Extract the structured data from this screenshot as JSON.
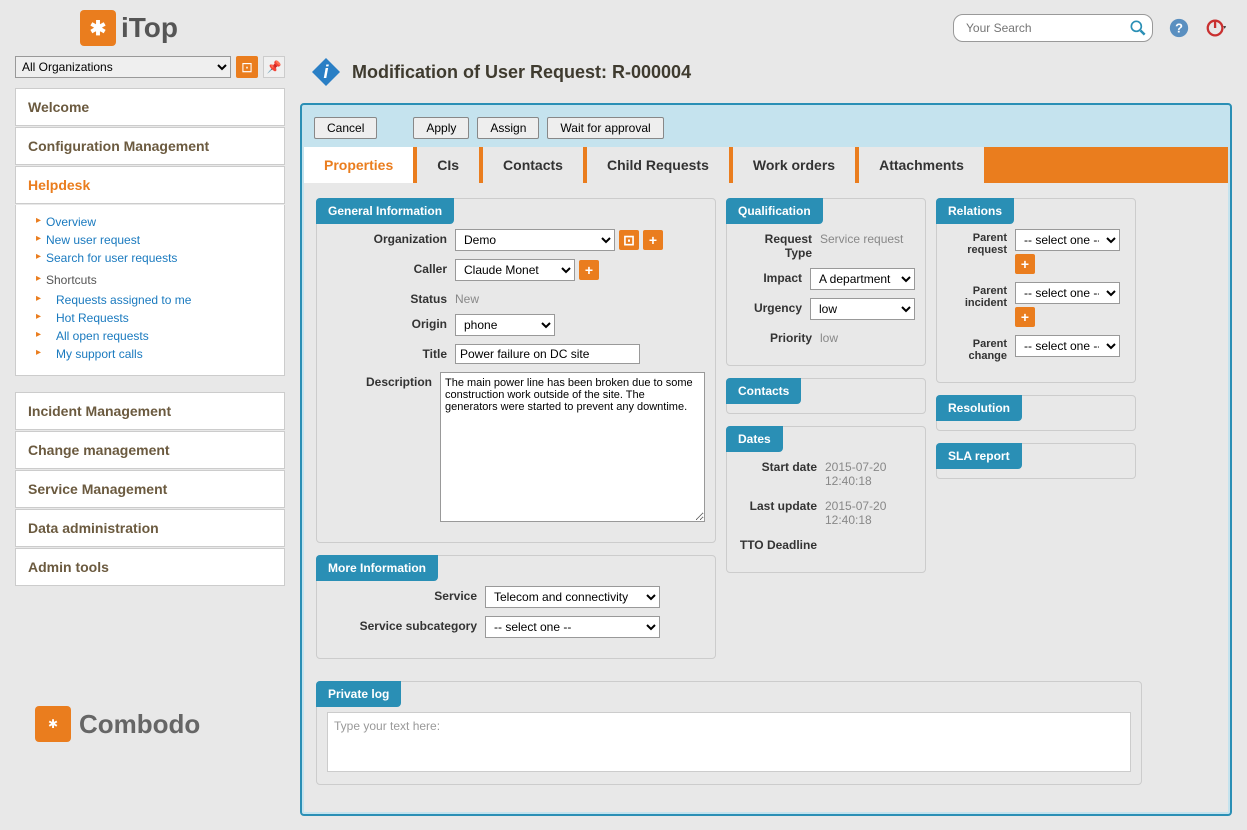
{
  "app": {
    "name": "iTop",
    "vendor": "Combodo"
  },
  "search": {
    "placeholder": "Your Search"
  },
  "org_selector": {
    "value": "All Organizations"
  },
  "nav": {
    "welcome": "Welcome",
    "config_mgmt": "Configuration Management",
    "helpdesk": "Helpdesk",
    "helpdesk_items": {
      "overview": "Overview",
      "new_request": "New user request",
      "search": "Search for user requests",
      "shortcuts": "Shortcuts",
      "assigned": "Requests assigned to me",
      "hot": "Hot Requests",
      "all_open": "All open requests",
      "my_calls": "My support calls"
    },
    "incident": "Incident Management",
    "change": "Change management",
    "service": "Service Management",
    "data_admin": "Data administration",
    "admin_tools": "Admin tools"
  },
  "page_title": "Modification of User Request: R-000004",
  "actions": {
    "cancel": "Cancel",
    "apply": "Apply",
    "assign": "Assign",
    "wait": "Wait for approval"
  },
  "tabs": {
    "properties": "Properties",
    "cis": "CIs",
    "contacts": "Contacts",
    "child": "Child Requests",
    "work_orders": "Work orders",
    "attachments": "Attachments"
  },
  "general": {
    "legend": "General Information",
    "labels": {
      "org": "Organization",
      "caller": "Caller",
      "status": "Status",
      "origin": "Origin",
      "title": "Title",
      "description": "Description"
    },
    "org": "Demo",
    "caller": "Claude Monet",
    "status": "New",
    "origin": "phone",
    "title": "Power failure on DC site",
    "description": "The main power line has been broken due to some construction work outside of the site. The generators were started to prevent any downtime."
  },
  "more_info": {
    "legend": "More Information",
    "labels": {
      "service": "Service",
      "subcategory": "Service subcategory"
    },
    "service": "Telecom and connectivity",
    "subcategory": "-- select one --"
  },
  "private_log": {
    "legend": "Private log",
    "placeholder": "Type your text here:"
  },
  "qualification": {
    "legend": "Qualification",
    "labels": {
      "req_type": "Request Type",
      "impact": "Impact",
      "urgency": "Urgency",
      "priority": "Priority"
    },
    "req_type": "Service request",
    "impact": "A department",
    "urgency": "low",
    "priority": "low"
  },
  "contacts_section": {
    "legend": "Contacts"
  },
  "dates": {
    "legend": "Dates",
    "labels": {
      "start": "Start date",
      "last_update": "Last update",
      "tto": "TTO Deadline"
    },
    "start": "2015-07-20 12:40:18",
    "last_update": "2015-07-20 12:40:18",
    "tto": ""
  },
  "relations": {
    "legend": "Relations",
    "labels": {
      "parent_request": "Parent request",
      "parent_incident": "Parent incident",
      "parent_change": "Parent change"
    },
    "select_one": "-- select one --"
  },
  "resolution": {
    "legend": "Resolution"
  },
  "sla": {
    "legend": "SLA report"
  }
}
